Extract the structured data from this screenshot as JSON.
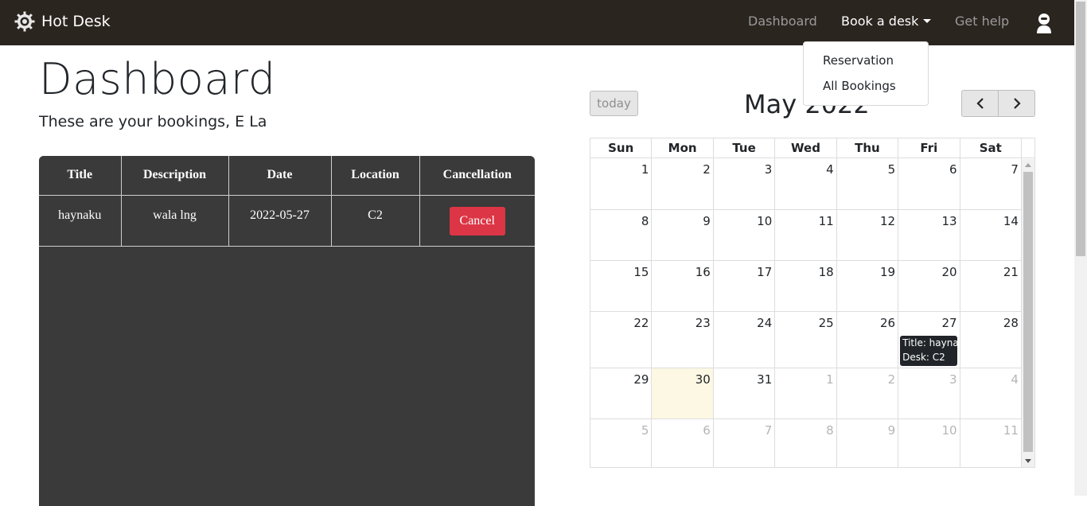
{
  "navbar": {
    "brand": "Hot Desk",
    "links": {
      "dashboard": "Dashboard",
      "book": "Book a desk",
      "help": "Get help"
    },
    "dropdown": [
      "Reservation",
      "All Bookings"
    ]
  },
  "main": {
    "title": "Dashboard",
    "subtitle": "These are your bookings, E La"
  },
  "bookings": {
    "columns": [
      "Title",
      "Description",
      "Date",
      "Location",
      "Cancellation"
    ],
    "rows": [
      {
        "title": "haynaku",
        "description": "wala lng",
        "date": "2022-05-27",
        "location": "C2",
        "action": "Cancel"
      }
    ]
  },
  "calendar": {
    "today_label": "today",
    "title": "May 2022",
    "weekdays": [
      "Sun",
      "Mon",
      "Tue",
      "Wed",
      "Thu",
      "Fri",
      "Sat"
    ],
    "weeks": [
      [
        "1",
        "2",
        "3",
        "4",
        "5",
        "6",
        "7"
      ],
      [
        "8",
        "9",
        "10",
        "11",
        "12",
        "13",
        "14"
      ],
      [
        "15",
        "16",
        "17",
        "18",
        "19",
        "20",
        "21"
      ],
      [
        "22",
        "23",
        "24",
        "25",
        "26",
        "27",
        "28"
      ],
      [
        "29",
        "30",
        "31",
        "1",
        "2",
        "3",
        "4"
      ],
      [
        "5",
        "6",
        "7",
        "8",
        "9",
        "10",
        "11"
      ]
    ],
    "event": {
      "line1": "Title: haynaku",
      "line2": "Desk: C2"
    }
  },
  "colors": {
    "navbar": "#2b2520",
    "danger": "#dc3545",
    "today_bg": "#fcf8e3",
    "table_bg": "#3a3a3a"
  }
}
